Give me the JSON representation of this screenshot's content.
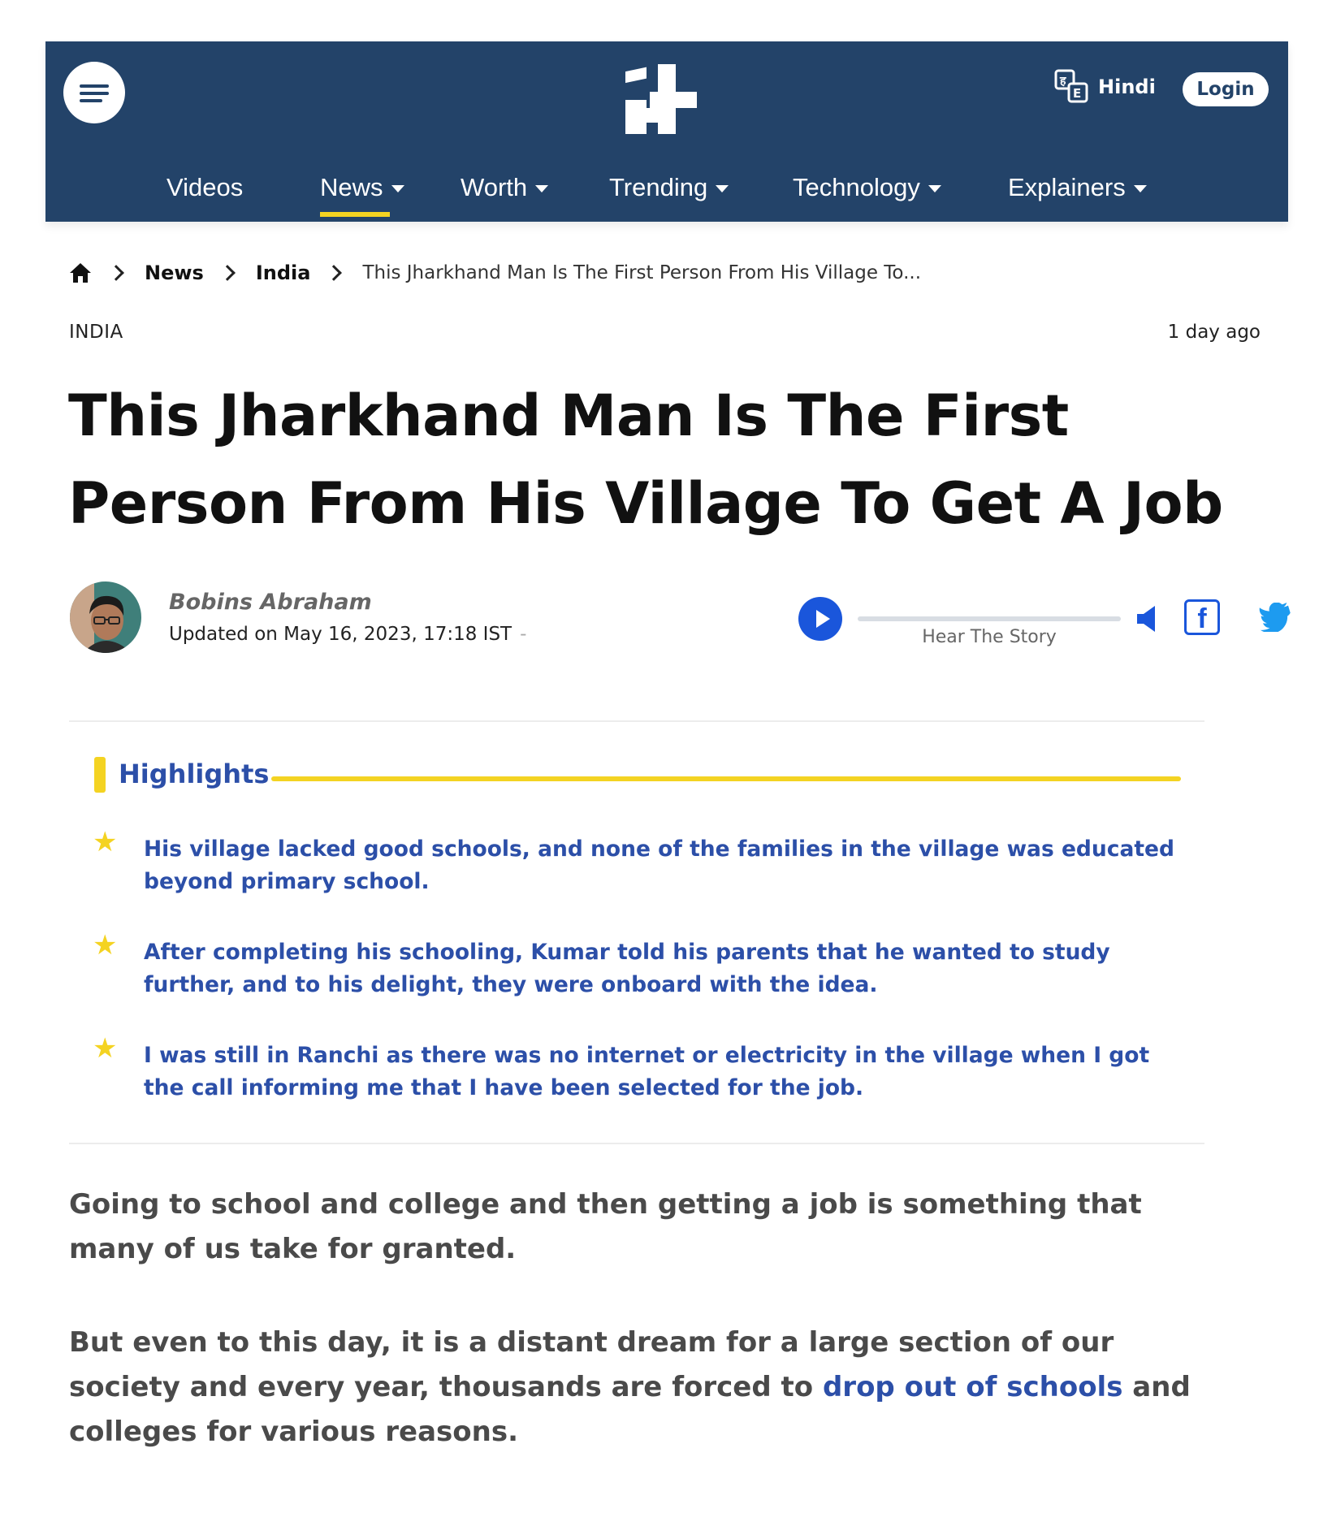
{
  "header": {
    "hindi_label": "Hindi",
    "login_label": "Login",
    "nav": [
      {
        "label": "Videos",
        "has_dropdown": false
      },
      {
        "label": "News",
        "has_dropdown": true,
        "active": true
      },
      {
        "label": "Worth",
        "has_dropdown": true
      },
      {
        "label": "Trending",
        "has_dropdown": true
      },
      {
        "label": "Technology",
        "has_dropdown": true
      },
      {
        "label": "Explainers",
        "has_dropdown": true
      }
    ]
  },
  "breadcrumb": {
    "items": [
      "News",
      "India"
    ],
    "current": "This Jharkhand Man Is The First Person From His Village To..."
  },
  "article": {
    "category": "INDIA",
    "time_ago": "1 day ago",
    "headline": "This Jharkhand Man Is The First Person From His Village To Get A Job",
    "author": "Bobins Abraham",
    "updated": "Updated on May 16, 2023, 17:18 IST",
    "updated_sep": "-"
  },
  "audio": {
    "label": "Hear The Story",
    "progress": 0
  },
  "highlights": {
    "title": "Highlights",
    "items": [
      "His village lacked good schools, and none of the families in the village was educated beyond primary school.",
      "After completing his schooling, Kumar told his parents that he wanted to study further, and to his delight, they were onboard with the idea.",
      "I was still in Ranchi as there was no internet or electricity in the village when I got the call informing me that I have been selected for the job."
    ]
  },
  "body": {
    "para1": "Going to school and college and then getting a job is something that many of us take for granted.",
    "para2_before": "But even to this day, it is a distant dream for a large section of our society and every year, thousands are forced to ",
    "para2_link": "drop out of schools",
    "para2_after": " and colleges for various reasons."
  },
  "colors": {
    "header_bg": "#234369",
    "accent_yellow": "#f4d322",
    "link_blue": "#2c4fa8",
    "play_blue": "#1a56db"
  },
  "icons": [
    "menu-icon",
    "site-logo",
    "translate-icon",
    "home-icon",
    "chevron-right-icon",
    "play-icon",
    "volume-icon",
    "facebook-icon",
    "twitter-icon",
    "star-icon"
  ]
}
